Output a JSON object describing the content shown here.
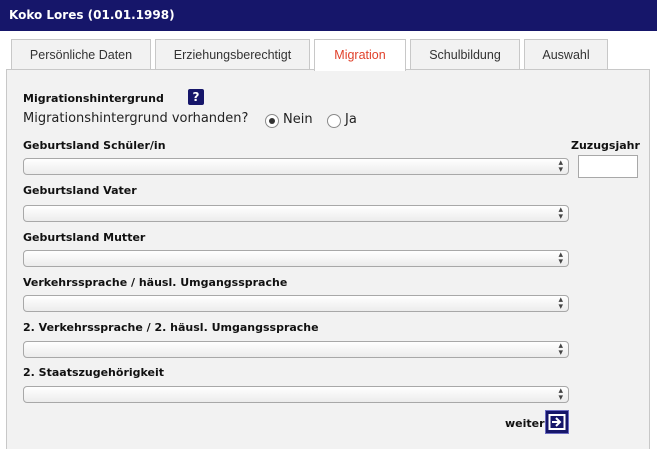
{
  "header": {
    "title": "Koko Lores (01.01.1998)"
  },
  "tabs": [
    {
      "label": "Persönliche Daten"
    },
    {
      "label": "Erziehungsberechtigt"
    },
    {
      "label": "Migration"
    },
    {
      "label": "Schulbildung"
    },
    {
      "label": "Auswahl"
    }
  ],
  "active_tab": "Migration",
  "form": {
    "section_title": "Migrationshintergrund",
    "help_label": "?",
    "question": "Migrationshintergrund vorhanden?",
    "options": [
      {
        "label": "Nein",
        "selected": true
      },
      {
        "label": "Ja",
        "selected": false
      }
    ],
    "fields": [
      {
        "label": "Geburtsland Schüler/in",
        "value": ""
      },
      {
        "label": "Geburtsland Vater",
        "value": ""
      },
      {
        "label": "Geburtsland Mutter",
        "value": ""
      },
      {
        "label": "Verkehrssprache / häusl. Umgangssprache",
        "value": ""
      },
      {
        "label": "2. Verkehrssprache / 2. häusl. Umgangssprache",
        "value": ""
      },
      {
        "label": "2. Staatszugehörigkeit",
        "value": ""
      }
    ],
    "zuzugsjahr_label": "Zuzugsjahr",
    "zuzugsjahr_value": "",
    "next_label": "weiter"
  },
  "colors": {
    "header_bg": "#16166a",
    "active_tab_text": "#e0402a",
    "panel_bg": "#f2f2f2"
  },
  "icons": {
    "help": "question-mark-icon",
    "next": "arrow-right-icon",
    "select_arrow": "up-down-arrows-icon"
  }
}
